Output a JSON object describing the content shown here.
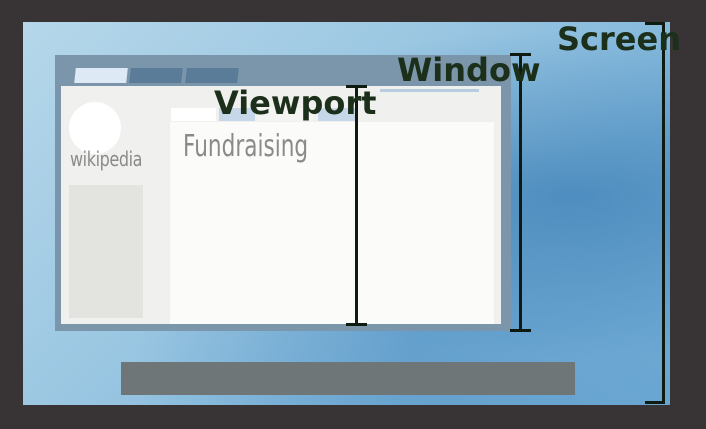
{
  "labels": {
    "screen": "Screen",
    "window": "Window",
    "viewport": "Viewport"
  },
  "page": {
    "logo_text": "wikipedia",
    "content_title": "Fundraising"
  },
  "colors": {
    "frame": "#383334",
    "window": "#7b95ab",
    "viewport": "#f0f0ee",
    "taskbar": "#6e7677",
    "label": "#1c2f1a"
  }
}
